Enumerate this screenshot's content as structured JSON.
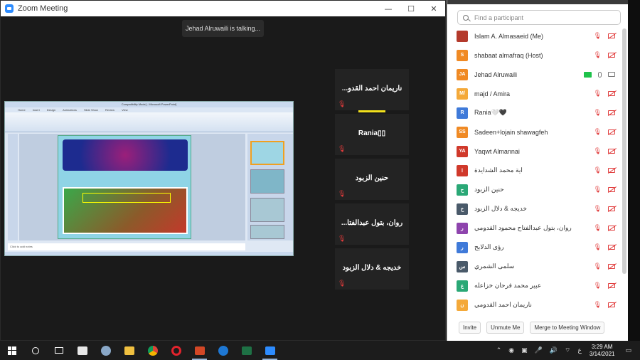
{
  "window": {
    "title": "Zoom Meeting"
  },
  "talking_banner": "Jehad Alruwaili is talking...",
  "shared_screen": {
    "title_bar": "Compatibility Mode] - Microsoft PowerPoint]",
    "tabs": [
      "Home",
      "Insert",
      "Design",
      "Animations",
      "Slide Show",
      "Review",
      "View"
    ],
    "notes_placeholder": "Click to add notes"
  },
  "video_tiles": [
    {
      "name": "...ناريمان احمد القدو"
    },
    {
      "name": "Rania▯▯"
    },
    {
      "name": "حنين الزبود"
    },
    {
      "name": "...روان، بتول عبدالفتا"
    },
    {
      "name": "خديجه & دلال الزبود"
    }
  ],
  "participants_panel": {
    "search_placeholder": "Find a participant",
    "items": [
      {
        "name": "Islam A. Almasaeid (Me)",
        "initial": "",
        "color": "#b43a2c"
      },
      {
        "name": "shabaat almafraq (Host)",
        "initial": "S",
        "color": "#f08a24"
      },
      {
        "name": "Jehad Alruwaili",
        "initial": "JA",
        "color": "#f08a24"
      },
      {
        "name": "majd / Amira",
        "initial": "M/",
        "color": "#f4a93a"
      },
      {
        "name": "Rania🤍🖤",
        "initial": "R",
        "color": "#3f7ad9"
      },
      {
        "name": "Sadeen+lojain shawagfeh",
        "initial": "SS",
        "color": "#f08a24"
      },
      {
        "name": "Yaqwt Almannai",
        "initial": "YA",
        "color": "#d0392b"
      },
      {
        "name": "اية محمد الشدايدة",
        "initial": "ا",
        "color": "#d0392b"
      },
      {
        "name": "حنين الزبود",
        "initial": "ح",
        "color": "#2aa876"
      },
      {
        "name": "خديجه & دلال الزبود",
        "initial": "خ",
        "color": "#4a5a6a"
      },
      {
        "name": "روان، بتول عبدالفتاح محمود القدومي",
        "initial": "ر",
        "color": "#8e44ad"
      },
      {
        "name": "رؤى الدلايح",
        "initial": "ر",
        "color": "#3f7ad9"
      },
      {
        "name": "سلمى الشمري",
        "initial": "س",
        "color": "#4a5a6a"
      },
      {
        "name": "عبير محمد فرحان خزاعله",
        "initial": "ع",
        "color": "#2aa876"
      },
      {
        "name": "ناريمان احمد القدومي",
        "initial": "ن",
        "color": "#f4a93a"
      }
    ],
    "buttons": {
      "invite": "Invite",
      "unmute": "Unmute Me",
      "merge": "Merge to Meeting Window"
    }
  },
  "taskbar": {
    "lang": "ع",
    "time": "3:29 AM",
    "date": "3/14/2021"
  },
  "colors": {
    "zoom_blue": "#2d8cff",
    "mute_red": "#e03b3b",
    "talking_yellow": "#f2e01c"
  }
}
